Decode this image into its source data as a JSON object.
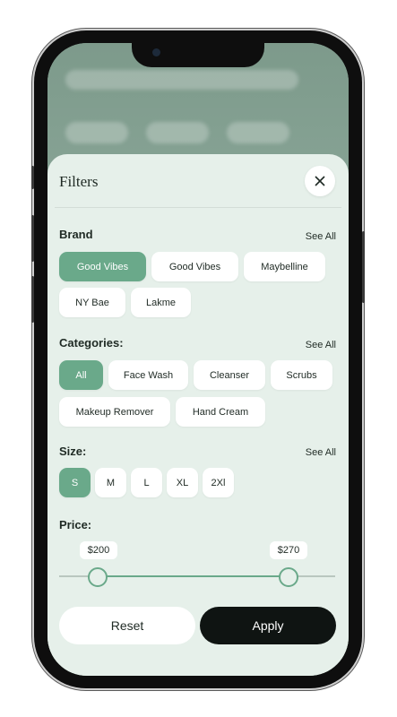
{
  "filters": {
    "title": "Filters",
    "close_icon": "close-icon"
  },
  "brand": {
    "label": "Brand",
    "see_all": "See All",
    "options": [
      "Good Vibes",
      "Good Vibes",
      "Maybelline",
      "NY Bae",
      "Lakme"
    ],
    "selected": "Good Vibes"
  },
  "categories": {
    "label": "Categories:",
    "see_all": "See All",
    "options": [
      "All",
      "Face Wash",
      "Cleanser",
      "Scrubs",
      "Makeup Remover",
      "Hand Cream"
    ],
    "selected": "All"
  },
  "size": {
    "label": "Size:",
    "see_all": "See All",
    "options": [
      "S",
      "M",
      "L",
      "XL",
      "2Xl"
    ],
    "selected": "S"
  },
  "price": {
    "label": "Price:",
    "min_label": "$200",
    "max_label": "$270"
  },
  "actions": {
    "reset": "Reset",
    "apply": "Apply"
  },
  "colors": {
    "accent": "#6aa98a",
    "sheet_bg": "#e6f0ea",
    "apply_bg": "#0f1412"
  }
}
